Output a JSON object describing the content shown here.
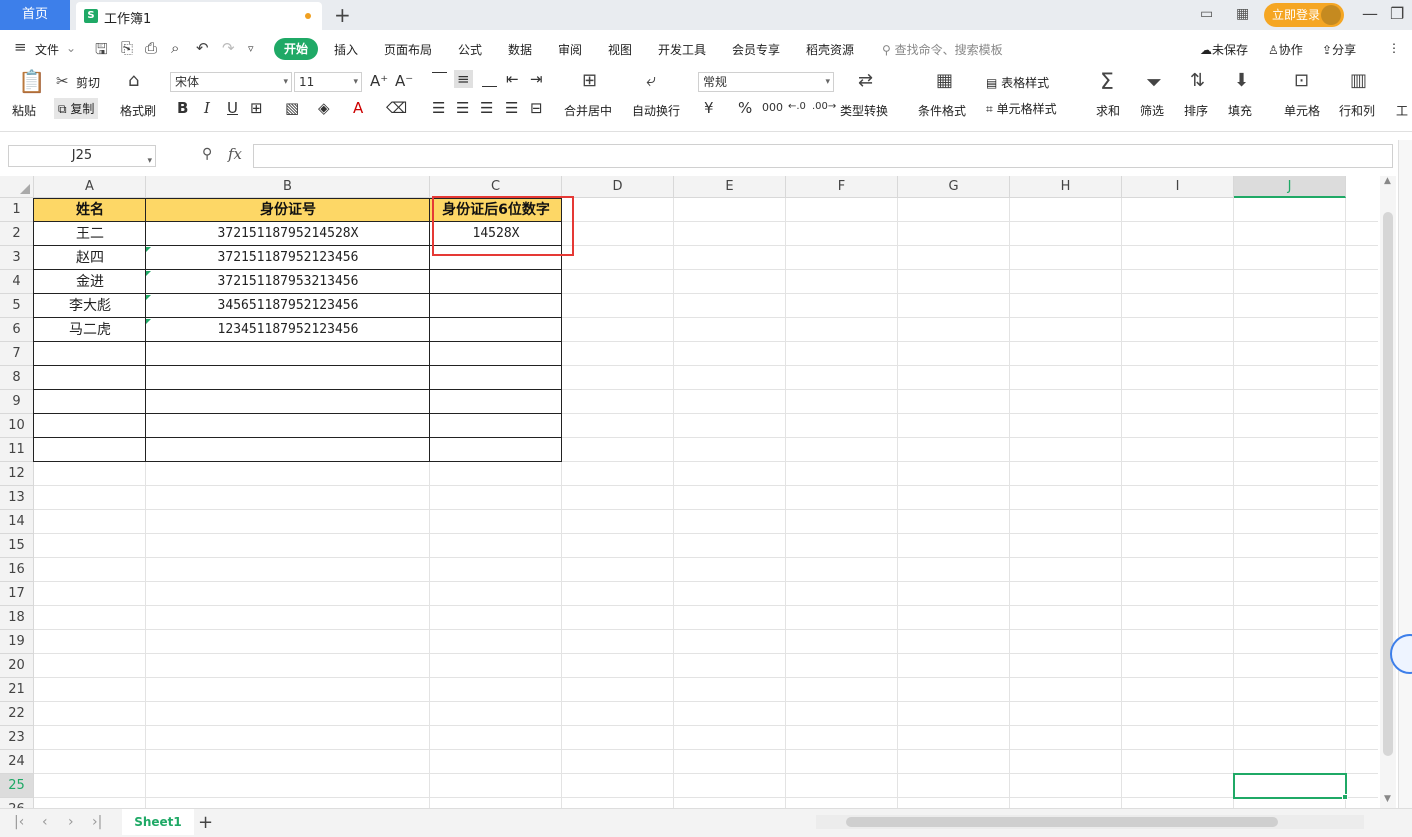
{
  "titlebar": {
    "home_tab": "首页",
    "doc_icon": "S",
    "doc_title": "工作簿1",
    "login": "立即登录"
  },
  "menubar": {
    "file": "文件",
    "items": [
      "开始",
      "插入",
      "页面布局",
      "公式",
      "数据",
      "审阅",
      "视图",
      "开发工具",
      "会员专享",
      "稻壳资源"
    ],
    "search_hint": "查找命令、搜索模板",
    "unsaved": "未保存",
    "collab": "协作",
    "share": "分享"
  },
  "ribbon": {
    "paste": "粘贴",
    "cut": "剪切",
    "copy": "复制",
    "format_painter": "格式刷",
    "font_name": "宋体",
    "font_size": "11",
    "merge_center": "合并居中",
    "wrap_text": "自动换行",
    "number_format": "常规",
    "type_convert": "类型转换",
    "cond_format": "条件格式",
    "table_style": "表格样式",
    "cell_style": "单元格样式",
    "sum": "求和",
    "filter": "筛选",
    "sort": "排序",
    "fill": "填充",
    "cell": "单元格",
    "row_col": "行和列",
    "worksheet": "工"
  },
  "formula": {
    "name_box": "J25",
    "fx": "fx",
    "value": ""
  },
  "sheet": {
    "columns": [
      "A",
      "B",
      "C",
      "D",
      "E",
      "F",
      "G",
      "H",
      "I",
      "J"
    ],
    "selected_column": "J",
    "rows": [
      "1",
      "2",
      "3",
      "4",
      "5",
      "6",
      "7",
      "8",
      "9",
      "10",
      "11",
      "12",
      "13",
      "14",
      "15",
      "16",
      "17",
      "18",
      "19",
      "20",
      "21",
      "22",
      "23",
      "24",
      "25",
      "26"
    ],
    "selected_row": "25",
    "header": {
      "a": "姓名",
      "b": "身份证号",
      "c": "身份证后6位数字"
    },
    "data": [
      {
        "name": "王二",
        "id": "37215118795214528X",
        "last6": "14528X"
      },
      {
        "name": "赵四",
        "id": "372151187952123456",
        "last6": ""
      },
      {
        "name": "金进",
        "id": "372151187953213456",
        "last6": ""
      },
      {
        "name": "李大彪",
        "id": "345651187952123456",
        "last6": ""
      },
      {
        "name": "马二虎",
        "id": "123451187952123456",
        "last6": ""
      }
    ]
  },
  "sheetbar": {
    "tab": "Sheet1"
  },
  "colors": {
    "accent": "#1fa966",
    "header_fill": "#fdd766",
    "highlight": "#e53935",
    "home_tab": "#3d7fea",
    "login": "#f5a623"
  }
}
